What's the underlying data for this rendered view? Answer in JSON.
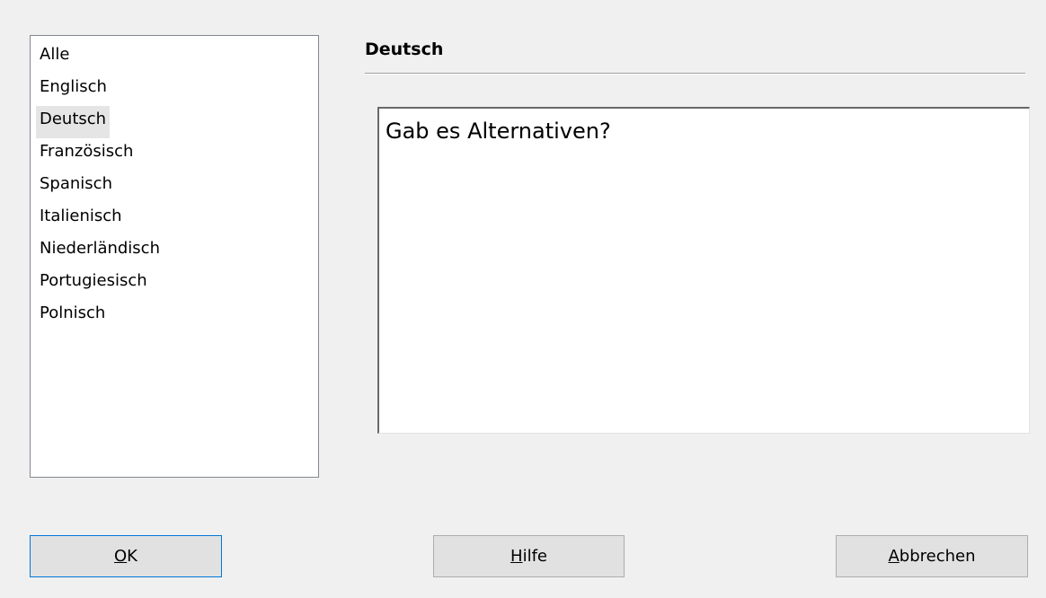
{
  "language_list": {
    "items": [
      {
        "label": "Alle",
        "selected": false
      },
      {
        "label": "Englisch",
        "selected": false
      },
      {
        "label": "Deutsch",
        "selected": true
      },
      {
        "label": "Französisch",
        "selected": false
      },
      {
        "label": "Spanisch",
        "selected": false
      },
      {
        "label": "Italienisch",
        "selected": false
      },
      {
        "label": "Niederländisch",
        "selected": false
      },
      {
        "label": "Portugiesisch",
        "selected": false
      },
      {
        "label": "Polnisch",
        "selected": false
      }
    ]
  },
  "section": {
    "title": "Deutsch"
  },
  "text_area": {
    "value": "Gab es Alternativen?"
  },
  "buttons": {
    "ok": {
      "mnemonic": "O",
      "rest": "K"
    },
    "help": {
      "mnemonic": "H",
      "rest": "ilfe"
    },
    "cancel": {
      "mnemonic": "A",
      "rest": "bbrechen"
    }
  },
  "colors": {
    "window_bg": "#f0f0f0",
    "selection_bg": "#e5e5e5",
    "default_button_border": "#0078d7"
  }
}
